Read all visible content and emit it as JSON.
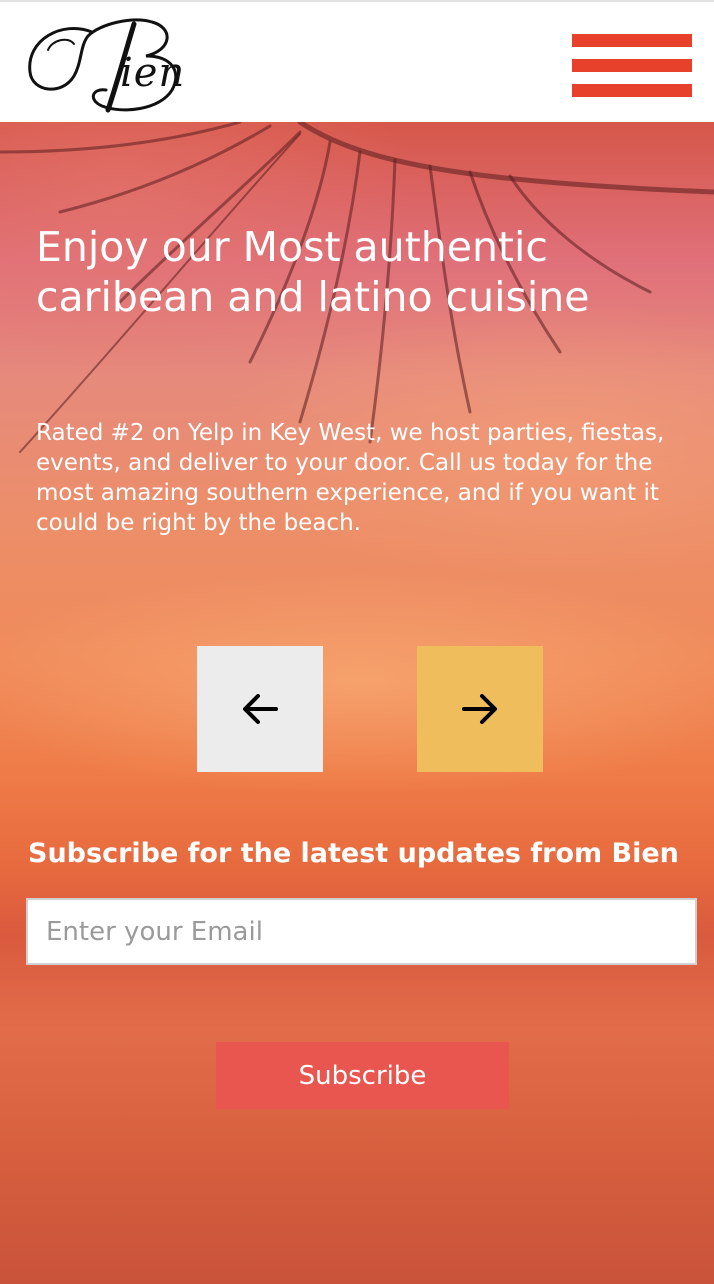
{
  "header": {
    "logo_text": "Bien",
    "logo_initial": "B",
    "logo_rest": "ien",
    "menu_color": "#e8412b"
  },
  "hero": {
    "title": "Enjoy our Most authentic caribean and latino cuisine",
    "body": "Rated #2 on Yelp in Key West, we host parties, fiestas, events, and deliver to your door. Call us today for the most amazing southern experience, and if you want it could be right by the beach.",
    "prev_icon": "arrow-left-icon",
    "next_icon": "arrow-right-icon",
    "next_color": "#f0bd5c"
  },
  "subscribe": {
    "heading": "Subscribe for the latest updates from Bien",
    "email_placeholder": "Enter your Email",
    "email_value": "",
    "button_label": "Subscribe",
    "button_color": "#e8564f"
  }
}
